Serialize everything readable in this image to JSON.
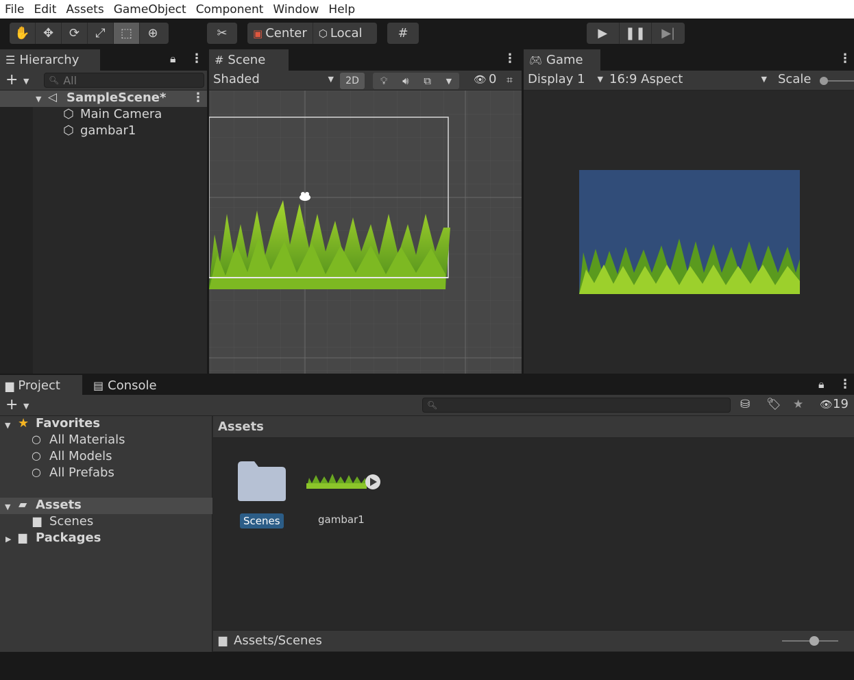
{
  "menu": [
    "File",
    "Edit",
    "Assets",
    "GameObject",
    "Component",
    "Window",
    "Help"
  ],
  "toolbar": {
    "pivot_center": "Center",
    "pivot_local": "Local"
  },
  "hierarchy": {
    "tab": "Hierarchy",
    "search_placeholder": "All",
    "scene": "SampleScene*",
    "items": [
      "Main Camera",
      "gambar1"
    ]
  },
  "scene": {
    "tab": "Scene",
    "shading": "Shaded",
    "mode2d": "2D",
    "hidden_count": "0"
  },
  "game": {
    "tab": "Game",
    "display": "Display 1",
    "aspect": "16:9 Aspect",
    "scale_label": "Scale",
    "background_color": "#314d79"
  },
  "project": {
    "tab_project": "Project",
    "tab_console": "Console",
    "hidden_count": "19",
    "favorites_label": "Favorites",
    "favorites": [
      "All Materials",
      "All Models",
      "All Prefabs"
    ],
    "assets_label": "Assets",
    "assets_children": [
      "Scenes"
    ],
    "packages_label": "Packages",
    "breadcrumb": "Assets",
    "grid_items": [
      "Scenes",
      "gambar1"
    ],
    "footer_path": "Assets/Scenes"
  },
  "colors": {
    "selection": "#2c5d87",
    "grass_dark": "#4f8f1d",
    "grass_light": "#9ad12a"
  }
}
